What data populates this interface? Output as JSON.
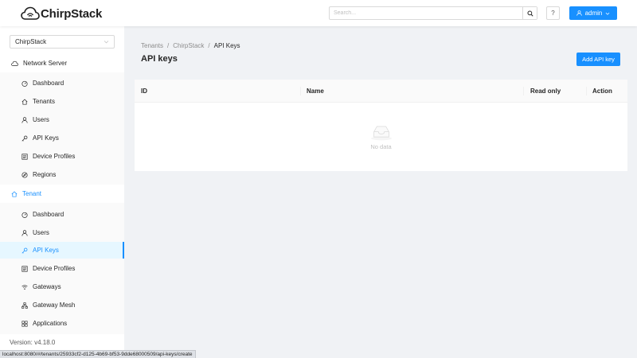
{
  "header": {
    "logo_text": "ChirpStack",
    "search_placeholder": "Search...",
    "help_label": "?",
    "user_label": "admin"
  },
  "sidebar": {
    "tenant_select_value": "ChirpStack",
    "network_server": {
      "label": "Network Server",
      "items": [
        {
          "label": "Dashboard",
          "icon": "dashboard-icon"
        },
        {
          "label": "Tenants",
          "icon": "home-icon"
        },
        {
          "label": "Users",
          "icon": "user-icon"
        },
        {
          "label": "API Keys",
          "icon": "key-icon"
        },
        {
          "label": "Device Profiles",
          "icon": "profile-icon"
        },
        {
          "label": "Regions",
          "icon": "compass-icon"
        }
      ]
    },
    "tenant": {
      "label": "Tenant",
      "items": [
        {
          "label": "Dashboard",
          "icon": "dashboard-icon"
        },
        {
          "label": "Users",
          "icon": "user-icon"
        },
        {
          "label": "API Keys",
          "icon": "key-icon",
          "selected": true
        },
        {
          "label": "Device Profiles",
          "icon": "profile-icon"
        },
        {
          "label": "Gateways",
          "icon": "wifi-icon"
        },
        {
          "label": "Gateway Mesh",
          "icon": "mesh-icon"
        },
        {
          "label": "Applications",
          "icon": "appstore-icon"
        }
      ]
    },
    "version": "Version: v4.18.0"
  },
  "breadcrumb": [
    "Tenants",
    "ChirpStack",
    "API Keys"
  ],
  "breadcrumb_separator": "/",
  "page": {
    "title": "API keys",
    "add_button_label": "Add API key"
  },
  "table": {
    "columns": [
      "ID",
      "Name",
      "Read only",
      "Action"
    ],
    "empty_text": "No data"
  },
  "status_bar": {
    "url": "localhost:8080/#/tenants/25933cf2-d125-4b69-bf53-9dde68000509/api-keys/create"
  },
  "colors": {
    "primary": "#1890ff",
    "selected_bg": "#e6f7ff",
    "page_bg": "#f0f2f5"
  }
}
